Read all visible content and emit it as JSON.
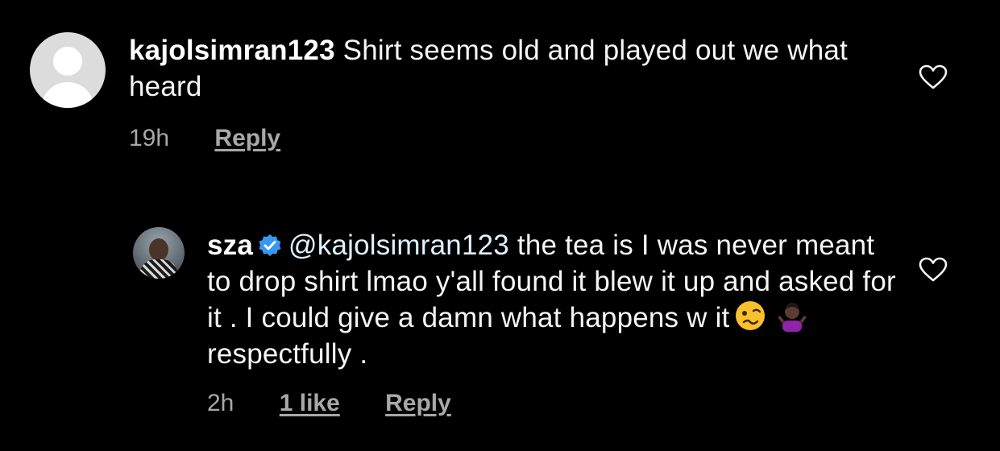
{
  "comments": [
    {
      "username": "kajolsimran123",
      "verified": false,
      "text": "Shirt seems old and played out we what heard",
      "time": "19h",
      "likes": "",
      "reply_label": "Reply",
      "avatar_icon": "default-avatar-icon"
    },
    {
      "username": "sza",
      "verified": true,
      "mention": "@kajolsimran123",
      "text_1": "the tea is I was never meant to drop shirt lmao y'all found it blew it up and asked for it . I could give a damn what happens w it",
      "text_2": "respectfully .",
      "emojis": [
        "woozy-face-emoji",
        "person-shrugging-emoji"
      ],
      "time": "2h",
      "likes": "1 like",
      "reply_label": "Reply",
      "avatar_icon": "profile-photo"
    }
  ],
  "colors": {
    "background": "#000000",
    "text": "#f5f5f5",
    "meta": "#a8a8a8",
    "verified": "#3897f0",
    "mention": "#e0f1ff"
  },
  "icons": {
    "like": "heart-outline-icon",
    "verified": "verified-badge-icon"
  }
}
